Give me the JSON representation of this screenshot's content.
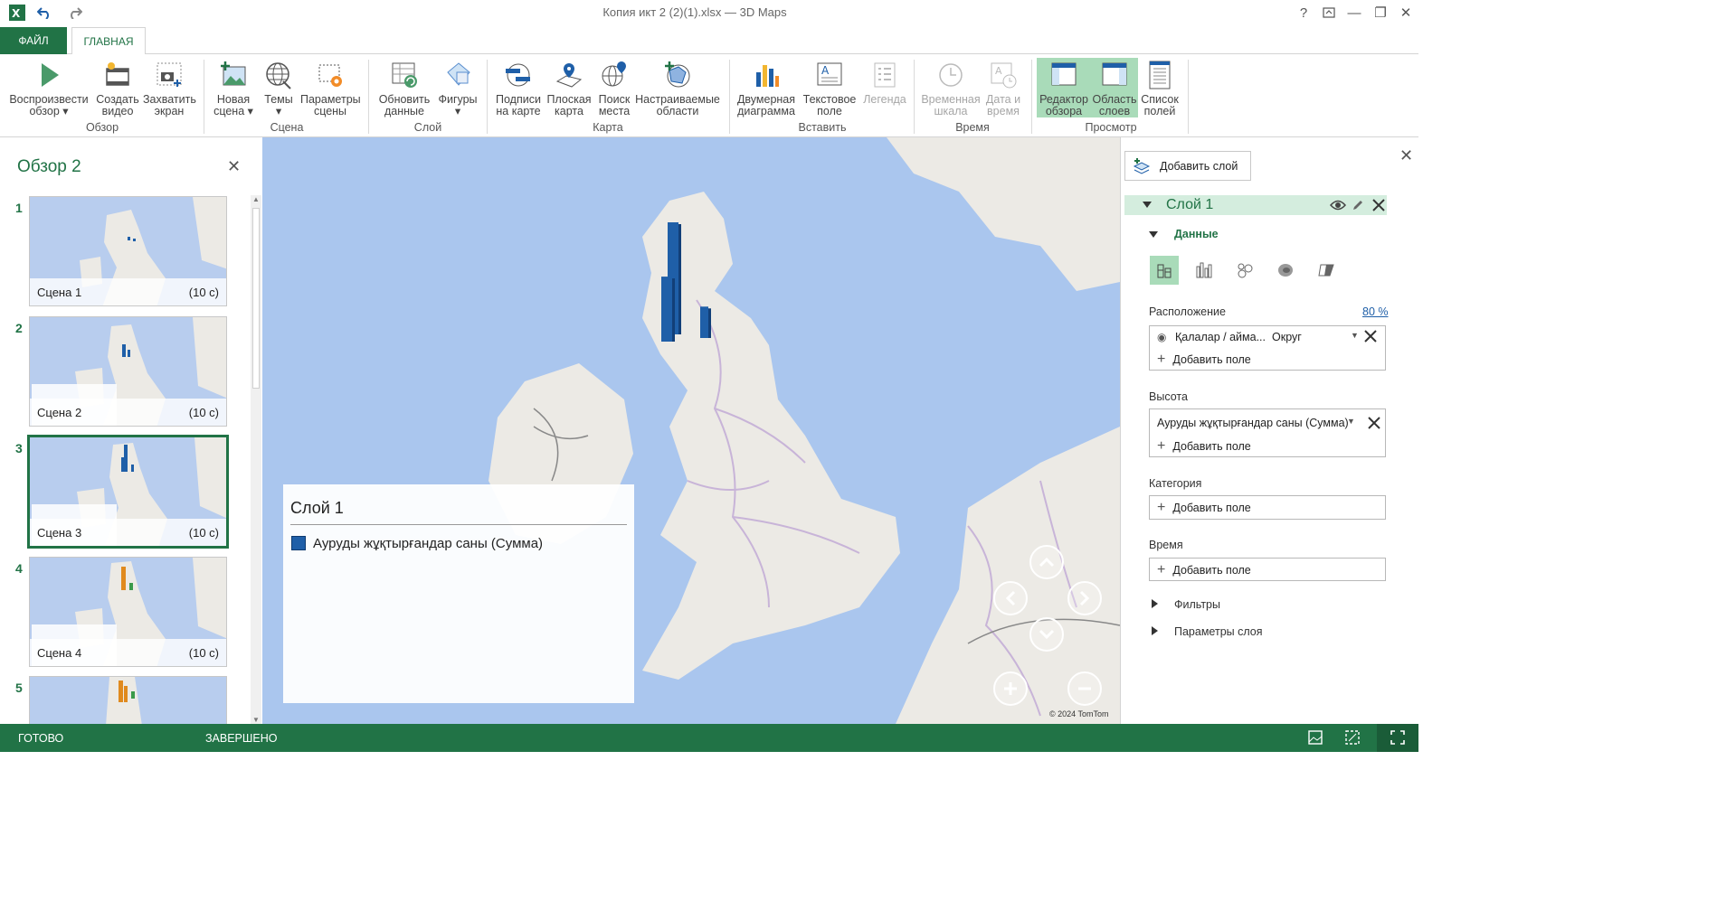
{
  "window": {
    "title": "Копия икт 2 (2)(1).xlsx — 3D Maps",
    "help": "?",
    "minimize": "—",
    "restore": "❐",
    "close": "✕"
  },
  "tabs": {
    "file": "ФАЙЛ",
    "home": "ГЛАВНАЯ"
  },
  "ribbon": {
    "play_tour": [
      "Воспроизвести",
      "обзор ▾"
    ],
    "create_video": [
      "Создать",
      "видео"
    ],
    "capture_screen": [
      "Захватить",
      "экран"
    ],
    "group_tour": "Обзор",
    "new_scene": [
      "Новая",
      "сцена ▾"
    ],
    "themes": [
      "Темы",
      "▾"
    ],
    "scene_options": [
      "Параметры",
      "сцены"
    ],
    "group_scene": "Сцена",
    "refresh_data": [
      "Обновить",
      "данные"
    ],
    "shapes": [
      "Фигуры",
      "▾"
    ],
    "group_layer": "Слой",
    "map_labels": [
      "Подписи",
      "на карте"
    ],
    "flat_map": [
      "Плоская",
      "карта"
    ],
    "find_location": [
      "Поиск",
      "места"
    ],
    "custom_regions": [
      "Настраиваемые",
      "области"
    ],
    "group_map": "Карта",
    "2d_chart": [
      "Двумерная",
      "диаграмма"
    ],
    "text_box": [
      "Текстовое",
      "поле"
    ],
    "legend": "Легенда",
    "group_insert": "Вставить",
    "timeline": [
      "Временная",
      "шкала"
    ],
    "date_time": [
      "Дата и",
      "время"
    ],
    "group_time": "Время",
    "tour_editor": [
      "Редактор",
      "обзора"
    ],
    "layer_pane": [
      "Область",
      "слоев"
    ],
    "field_list": [
      "Список",
      "полей"
    ],
    "group_view": "Просмотр"
  },
  "tour": {
    "title": "Обзор 2",
    "close": "✕",
    "scenes": [
      {
        "num": "1",
        "name": "Сцена 1",
        "duration": "(10 с)"
      },
      {
        "num": "2",
        "name": "Сцена 2",
        "duration": "(10 с)"
      },
      {
        "num": "3",
        "name": "Сцена 3",
        "duration": "(10 с)"
      },
      {
        "num": "4",
        "name": "Сцена 4",
        "duration": "(10 с)"
      },
      {
        "num": "5",
        "name": "",
        "duration": ""
      }
    ]
  },
  "map": {
    "legend_title": "Слой 1",
    "legend_series": "Ауруды жұқтырғандар саны (Сумма)",
    "copyright": "© 2024 TomTom",
    "series_color": "#1f5fa8",
    "chart_data": {
      "type": "bar",
      "series": [
        {
          "name": "Ауруды жұқтырғандар саны (Сумма)",
          "values": [
            100,
            58,
            28
          ]
        }
      ]
    }
  },
  "pane": {
    "close": "✕",
    "add_layer": "Добавить слой",
    "layer_name": "Слой 1",
    "data_section": "Данные",
    "location_label": "Расположение",
    "location_pct": "80 %",
    "location_field": "Қалалар / айма...",
    "location_type": "Округ",
    "add_field": "Добавить поле",
    "height_label": "Высота",
    "height_field": "Ауруды жұқтырғандар саны (Сумма)",
    "category_label": "Категория",
    "time_label": "Время",
    "filters": "Фильтры",
    "layer_options": "Параметры слоя"
  },
  "status": {
    "ready": "ГОТОВО",
    "done": "ЗАВЕРШЕНО"
  },
  "colors": {
    "accent": "#217346",
    "highlight": "#a9dbb9",
    "layer_bar": "#d4edde",
    "water": "#aac6ee",
    "land": "#eceae5"
  }
}
